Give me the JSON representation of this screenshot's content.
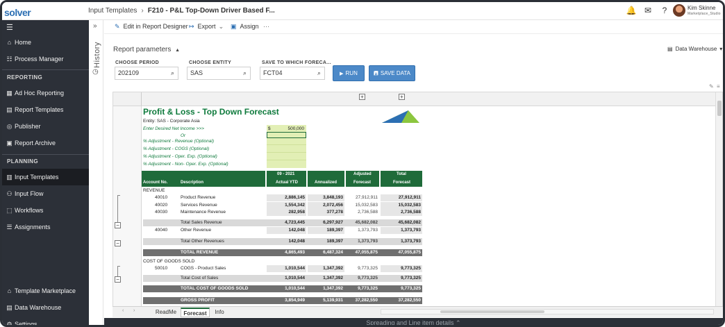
{
  "app": {
    "logo_text": "solver"
  },
  "breadcrumb": {
    "parent": "Input Templates",
    "current": "F210 - P&L Top-Down Driver Based F..."
  },
  "user": {
    "name": "Kim Skinne",
    "org": "Marketplace_Studio"
  },
  "sidebar": {
    "items_top": [
      {
        "label": "Home",
        "icon": "home-icon"
      },
      {
        "label": "Process Manager",
        "icon": "process-icon"
      }
    ],
    "section_reporting": "REPORTING",
    "items_reporting": [
      {
        "label": "Ad Hoc Reporting",
        "icon": "adhoc-icon"
      },
      {
        "label": "Report Templates",
        "icon": "report-templates-icon"
      },
      {
        "label": "Publisher",
        "icon": "publisher-icon"
      },
      {
        "label": "Report Archive",
        "icon": "archive-icon"
      }
    ],
    "section_planning": "PLANNING",
    "items_planning": [
      {
        "label": "Input Templates",
        "icon": "input-templates-icon",
        "active": true
      },
      {
        "label": "Input Flow",
        "icon": "input-flow-icon"
      },
      {
        "label": "Workflows",
        "icon": "workflows-icon"
      },
      {
        "label": "Assignments",
        "icon": "assignments-icon"
      }
    ],
    "items_bottom": [
      {
        "label": "Template Marketplace",
        "icon": "marketplace-icon"
      },
      {
        "label": "Data Warehouse",
        "icon": "warehouse-icon"
      },
      {
        "label": "Settings",
        "icon": "settings-icon"
      }
    ]
  },
  "history": {
    "label": "History"
  },
  "toolbar": {
    "edit": "Edit in Report Designer",
    "export": "Export",
    "assign": "Assign",
    "more": "···"
  },
  "params": {
    "title": "Report parameters",
    "period_label": "CHOOSE PERIOD",
    "period_value": "202109",
    "entity_label": "CHOOSE ENTITY",
    "entity_value": "SAS",
    "save_label": "SAVE TO WHICH FORECA...",
    "save_value": "FCT04",
    "run": "RUN",
    "save_data": "SAVE DATA",
    "data_warehouse": "Data Warehouse"
  },
  "report": {
    "title": "Profit & Loss - Top Down Forecast",
    "entity": "Entity: SAS - Corporate Asia",
    "prompts": [
      "Enter Desired Net Income >>>",
      "Or",
      "% Adjustment - Revenue (Optional)",
      "% Adjustment - COGS (Optional)",
      "% Adjustment - Oper. Exp. (Optional)",
      "% Adjustment - Non- Oper. Exp. (Optional)"
    ],
    "net_income_currency": "$",
    "net_income_value": "500,000",
    "headers": {
      "account": "Account No.",
      "description": "Description",
      "period_top": "09 - 2021",
      "period_bottom": "Actual YTD",
      "annualized": "Annualized",
      "adjusted_top": "Adjusted",
      "adjusted_bottom": "Forecast",
      "total_top": "Total",
      "total_bottom": "Forecast"
    },
    "revenue_label": "REVENUE",
    "cogs_label": "COST OF GOODS SOLD",
    "rows": [
      {
        "acct": "40010",
        "desc": "Product Revenue",
        "ytd": "2,886,145",
        "ann": "3,848,193",
        "adj": "27,912,911",
        "tot": "27,912,911",
        "kind": "item"
      },
      {
        "acct": "40020",
        "desc": "Services Revenue",
        "ytd": "1,554,342",
        "ann": "2,072,456",
        "adj": "15,032,583",
        "tot": "15,032,583",
        "kind": "item"
      },
      {
        "acct": "40030",
        "desc": "Maintenance Revenue",
        "ytd": "282,958",
        "ann": "377,278",
        "adj": "2,736,588",
        "tot": "2,736,588",
        "kind": "item"
      },
      {
        "acct": "",
        "desc": "Total Sales Revenue",
        "ytd": "4,723,445",
        "ann": "6,297,927",
        "adj": "45,682,082",
        "tot": "45,682,082",
        "kind": "subtotal"
      },
      {
        "acct": "40040",
        "desc": "Other Revenue",
        "ytd": "142,048",
        "ann": "189,397",
        "adj": "1,373,793",
        "tot": "1,373,793",
        "kind": "item"
      },
      {
        "acct": "",
        "desc": "Total Other Revenues",
        "ytd": "142,048",
        "ann": "189,397",
        "adj": "1,373,793",
        "tot": "1,373,793",
        "kind": "subtotal"
      },
      {
        "acct": "",
        "desc": "TOTAL REVENUE",
        "ytd": "4,865,493",
        "ann": "6,487,324",
        "adj": "47,055,875",
        "tot": "47,055,875",
        "kind": "grand"
      },
      {
        "acct": "50010",
        "desc": "COGS - Product Sales",
        "ytd": "1,010,544",
        "ann": "1,347,392",
        "adj": "9,773,325",
        "tot": "9,773,325",
        "kind": "item"
      },
      {
        "acct": "",
        "desc": "Total Cost of Sales",
        "ytd": "1,010,544",
        "ann": "1,347,392",
        "adj": "9,773,325",
        "tot": "9,773,325",
        "kind": "subtotal"
      },
      {
        "acct": "",
        "desc": "TOTAL COST OF GOODS SOLD",
        "ytd": "1,010,544",
        "ann": "1,347,392",
        "adj": "9,773,325",
        "tot": "9,773,325",
        "kind": "grand"
      },
      {
        "acct": "",
        "desc": "GROSS PROFIT",
        "ytd": "3,854,949",
        "ann": "5,139,931",
        "adj": "37,282,550",
        "tot": "37,282,550",
        "kind": "grand"
      }
    ]
  },
  "sheet_tabs": [
    "ReadMe",
    "Forecast",
    "Info"
  ],
  "active_tab": "Forecast",
  "footer": {
    "label": "Spreading and Line item details"
  },
  "colors": {
    "sidebar": "#2c3038",
    "brand_green": "#1f6b3a",
    "button_blue": "#4c89c8",
    "input_yellow": "#e2efb5"
  }
}
